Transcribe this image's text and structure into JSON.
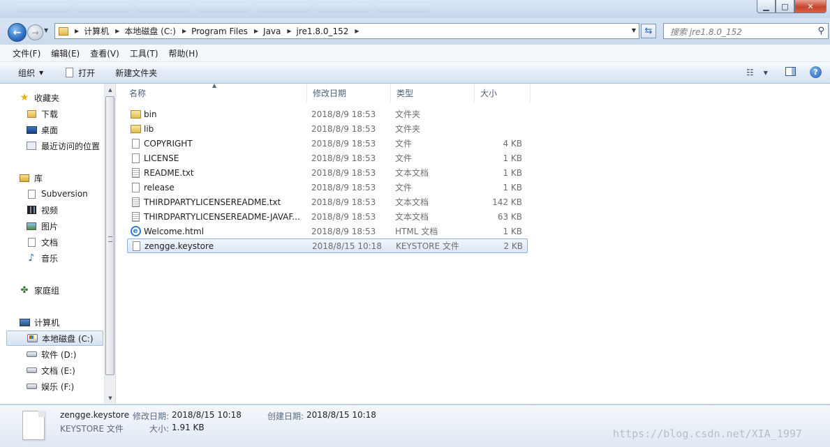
{
  "window": {
    "controls": {
      "minimize": "▁",
      "maximize": "□",
      "close": "✕"
    }
  },
  "address": {
    "crumbs": [
      "计算机",
      "本地磁盘 (C:)",
      "Program Files",
      "Java",
      "jre1.8.0_152"
    ],
    "search_placeholder": "搜索 jre1.8.0_152"
  },
  "menu": [
    "文件(F)",
    "编辑(E)",
    "查看(V)",
    "工具(T)",
    "帮助(H)"
  ],
  "toolbar": {
    "organize": "组织",
    "open": "打开",
    "new_folder": "新建文件夹"
  },
  "nav": {
    "favorites": {
      "label": "收藏夹",
      "items": [
        "下载",
        "桌面",
        "最近访问的位置"
      ]
    },
    "libraries": {
      "label": "库",
      "items": [
        "Subversion",
        "视频",
        "图片",
        "文档",
        "音乐"
      ]
    },
    "homegroup": "家庭组",
    "computer": {
      "label": "计算机",
      "items": [
        "本地磁盘 (C:)",
        "软件 (D:)",
        "文档 (E:)",
        "娱乐 (F:)"
      ]
    }
  },
  "columns": [
    "名称",
    "修改日期",
    "类型",
    "大小"
  ],
  "files": [
    {
      "name": "bin",
      "date": "2018/8/9 18:53",
      "type": "文件夹",
      "size": "",
      "icon": "folder-icon"
    },
    {
      "name": "lib",
      "date": "2018/8/9 18:53",
      "type": "文件夹",
      "size": "",
      "icon": "folder-icon"
    },
    {
      "name": "COPYRIGHT",
      "date": "2018/8/9 18:53",
      "type": "文件",
      "size": "4 KB",
      "icon": "file-icon"
    },
    {
      "name": "LICENSE",
      "date": "2018/8/9 18:53",
      "type": "文件",
      "size": "1 KB",
      "icon": "file-icon"
    },
    {
      "name": "README.txt",
      "date": "2018/8/9 18:53",
      "type": "文本文档",
      "size": "1 KB",
      "icon": "text-file-icon"
    },
    {
      "name": "release",
      "date": "2018/8/9 18:53",
      "type": "文件",
      "size": "1 KB",
      "icon": "file-icon"
    },
    {
      "name": "THIRDPARTYLICENSEREADME.txt",
      "date": "2018/8/9 18:53",
      "type": "文本文档",
      "size": "142 KB",
      "icon": "text-file-icon"
    },
    {
      "name": "THIRDPARTYLICENSEREADME-JAVAF...",
      "date": "2018/8/9 18:53",
      "type": "文本文档",
      "size": "63 KB",
      "icon": "text-file-icon"
    },
    {
      "name": "Welcome.html",
      "date": "2018/8/9 18:53",
      "type": "HTML 文档",
      "size": "1 KB",
      "icon": "html-file-icon"
    },
    {
      "name": "zengge.keystore",
      "date": "2018/8/15 10:18",
      "type": "KEYSTORE 文件",
      "size": "2 KB",
      "icon": "file-icon",
      "selected": true
    }
  ],
  "details": {
    "name": "zengge.keystore",
    "type": "KEYSTORE 文件",
    "modified_label": "修改日期:",
    "modified": "2018/8/15 10:18",
    "created_label": "创建日期:",
    "created": "2018/8/15 10:18",
    "size_label": "大小:",
    "size": "1.91 KB"
  },
  "watermark": "https://blog.csdn.net/XIA_1997"
}
